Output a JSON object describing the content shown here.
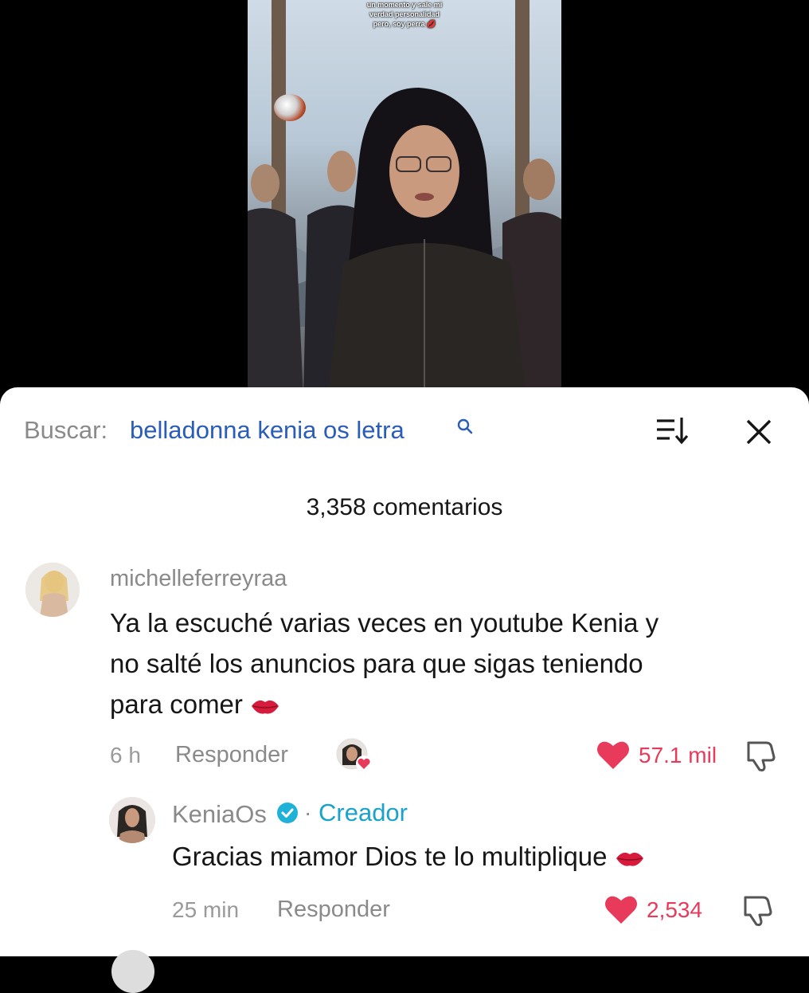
{
  "video": {
    "caption_lines": [
      "un momento y sale mi",
      "verdad personalidad",
      "pero, soy perra 💋"
    ]
  },
  "search": {
    "label": "Buscar:",
    "query": "belladonna kenia os letra"
  },
  "comments_count": "3,358 comentarios",
  "comments": [
    {
      "username": "michelleferreyraa",
      "text_lines": [
        "Ya la escuché varias veces en youtube Kenia y",
        "no salté los anuncios para que sigas teniendo",
        "para comer"
      ],
      "time": "6 h",
      "reply_label": "Responder",
      "likes": "57.1 mil",
      "creator_liked": true
    }
  ],
  "reply": {
    "username": "KeniaOs",
    "separator": "·",
    "creator_label": "Creador",
    "text": "Gracias miamor Dios te lo multiplique",
    "time": "25 min",
    "reply_label": "Responder",
    "likes": "2,534"
  },
  "colors": {
    "like": "#e83a5a",
    "creator": "#1aa3c8",
    "search_query": "#2a5db8"
  },
  "icons": [
    "search-icon",
    "sort-icon",
    "close-icon",
    "heart-icon",
    "dislike-icon",
    "verified-icon",
    "kiss-emoji"
  ]
}
